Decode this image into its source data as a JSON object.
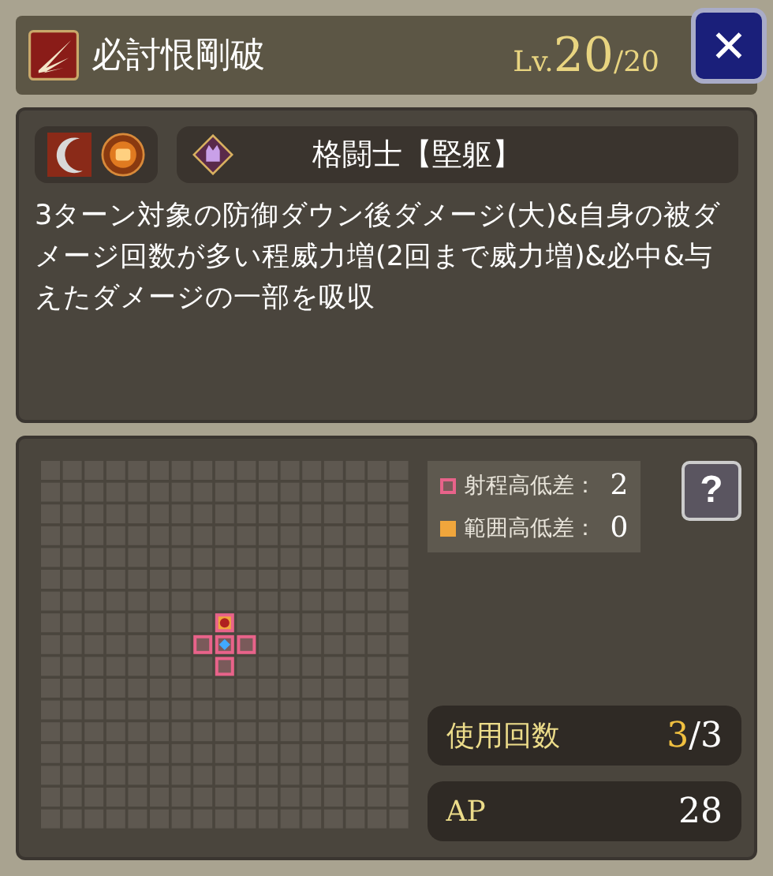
{
  "header": {
    "title": "必討恨剛破",
    "level_prefix": "Lv.",
    "level": "20",
    "level_max": "/20",
    "close": "✕"
  },
  "skill": {
    "job": "格闘士【堅躯】",
    "description": "3ターン対象の防御ダウン後ダメージ(大)&自身の被ダメージ回数が多い程威力増(2回まで威力増)&必中&与えたダメージの一部を吸収"
  },
  "range_grid": {
    "rows": [
      {
        "cells": [
          {
            "kind": "empty"
          },
          {
            "kind": "empty"
          },
          {
            "kind": "empty"
          },
          {
            "kind": "empty"
          },
          {
            "kind": "empty"
          },
          {
            "kind": "empty"
          },
          {
            "kind": "empty"
          },
          {
            "kind": "empty"
          },
          {
            "kind": "empty"
          },
          {
            "kind": "empty"
          },
          {
            "kind": "empty"
          },
          {
            "kind": "empty"
          },
          {
            "kind": "empty"
          },
          {
            "kind": "empty"
          },
          {
            "kind": "empty"
          },
          {
            "kind": "empty"
          },
          {
            "kind": "empty"
          }
        ]
      },
      {
        "cells": [
          {
            "kind": "empty"
          },
          {
            "kind": "empty"
          },
          {
            "kind": "empty"
          },
          {
            "kind": "empty"
          },
          {
            "kind": "empty"
          },
          {
            "kind": "empty"
          },
          {
            "kind": "empty"
          },
          {
            "kind": "empty"
          },
          {
            "kind": "empty"
          },
          {
            "kind": "empty"
          },
          {
            "kind": "empty"
          },
          {
            "kind": "empty"
          },
          {
            "kind": "empty"
          },
          {
            "kind": "empty"
          },
          {
            "kind": "empty"
          },
          {
            "kind": "empty"
          },
          {
            "kind": "empty"
          }
        ]
      },
      {
        "cells": [
          {
            "kind": "empty"
          },
          {
            "kind": "empty"
          },
          {
            "kind": "empty"
          },
          {
            "kind": "empty"
          },
          {
            "kind": "empty"
          },
          {
            "kind": "empty"
          },
          {
            "kind": "empty"
          },
          {
            "kind": "empty"
          },
          {
            "kind": "empty"
          },
          {
            "kind": "empty"
          },
          {
            "kind": "empty"
          },
          {
            "kind": "empty"
          },
          {
            "kind": "empty"
          },
          {
            "kind": "empty"
          },
          {
            "kind": "empty"
          },
          {
            "kind": "empty"
          },
          {
            "kind": "empty"
          }
        ]
      },
      {
        "cells": [
          {
            "kind": "empty"
          },
          {
            "kind": "empty"
          },
          {
            "kind": "empty"
          },
          {
            "kind": "empty"
          },
          {
            "kind": "empty"
          },
          {
            "kind": "empty"
          },
          {
            "kind": "empty"
          },
          {
            "kind": "empty"
          },
          {
            "kind": "empty"
          },
          {
            "kind": "empty"
          },
          {
            "kind": "empty"
          },
          {
            "kind": "empty"
          },
          {
            "kind": "empty"
          },
          {
            "kind": "empty"
          },
          {
            "kind": "empty"
          },
          {
            "kind": "empty"
          },
          {
            "kind": "empty"
          }
        ]
      },
      {
        "cells": [
          {
            "kind": "empty"
          },
          {
            "kind": "empty"
          },
          {
            "kind": "empty"
          },
          {
            "kind": "empty"
          },
          {
            "kind": "empty"
          },
          {
            "kind": "empty"
          },
          {
            "kind": "empty"
          },
          {
            "kind": "empty"
          },
          {
            "kind": "empty"
          },
          {
            "kind": "empty"
          },
          {
            "kind": "empty"
          },
          {
            "kind": "empty"
          },
          {
            "kind": "empty"
          },
          {
            "kind": "empty"
          },
          {
            "kind": "empty"
          },
          {
            "kind": "empty"
          },
          {
            "kind": "empty"
          }
        ]
      },
      {
        "cells": [
          {
            "kind": "empty"
          },
          {
            "kind": "empty"
          },
          {
            "kind": "empty"
          },
          {
            "kind": "empty"
          },
          {
            "kind": "empty"
          },
          {
            "kind": "empty"
          },
          {
            "kind": "empty"
          },
          {
            "kind": "empty"
          },
          {
            "kind": "empty"
          },
          {
            "kind": "empty"
          },
          {
            "kind": "empty"
          },
          {
            "kind": "empty"
          },
          {
            "kind": "empty"
          },
          {
            "kind": "empty"
          },
          {
            "kind": "empty"
          },
          {
            "kind": "empty"
          },
          {
            "kind": "empty"
          }
        ]
      },
      {
        "cells": [
          {
            "kind": "empty"
          },
          {
            "kind": "empty"
          },
          {
            "kind": "empty"
          },
          {
            "kind": "empty"
          },
          {
            "kind": "empty"
          },
          {
            "kind": "empty"
          },
          {
            "kind": "empty"
          },
          {
            "kind": "empty"
          },
          {
            "kind": "empty"
          },
          {
            "kind": "empty"
          },
          {
            "kind": "empty"
          },
          {
            "kind": "empty"
          },
          {
            "kind": "empty"
          },
          {
            "kind": "empty"
          },
          {
            "kind": "empty"
          },
          {
            "kind": "empty"
          },
          {
            "kind": "empty"
          }
        ]
      },
      {
        "cells": [
          {
            "kind": "empty"
          },
          {
            "kind": "empty"
          },
          {
            "kind": "empty"
          },
          {
            "kind": "empty"
          },
          {
            "kind": "empty"
          },
          {
            "kind": "empty"
          },
          {
            "kind": "empty"
          },
          {
            "kind": "empty"
          },
          {
            "kind": "target"
          },
          {
            "kind": "empty"
          },
          {
            "kind": "empty"
          },
          {
            "kind": "empty"
          },
          {
            "kind": "empty"
          },
          {
            "kind": "empty"
          },
          {
            "kind": "empty"
          },
          {
            "kind": "empty"
          },
          {
            "kind": "empty"
          }
        ]
      },
      {
        "cells": [
          {
            "kind": "empty"
          },
          {
            "kind": "empty"
          },
          {
            "kind": "empty"
          },
          {
            "kind": "empty"
          },
          {
            "kind": "empty"
          },
          {
            "kind": "empty"
          },
          {
            "kind": "empty"
          },
          {
            "kind": "range"
          },
          {
            "kind": "caster"
          },
          {
            "kind": "range"
          },
          {
            "kind": "empty"
          },
          {
            "kind": "empty"
          },
          {
            "kind": "empty"
          },
          {
            "kind": "empty"
          },
          {
            "kind": "empty"
          },
          {
            "kind": "empty"
          },
          {
            "kind": "empty"
          }
        ]
      },
      {
        "cells": [
          {
            "kind": "empty"
          },
          {
            "kind": "empty"
          },
          {
            "kind": "empty"
          },
          {
            "kind": "empty"
          },
          {
            "kind": "empty"
          },
          {
            "kind": "empty"
          },
          {
            "kind": "empty"
          },
          {
            "kind": "empty"
          },
          {
            "kind": "range"
          },
          {
            "kind": "empty"
          },
          {
            "kind": "empty"
          },
          {
            "kind": "empty"
          },
          {
            "kind": "empty"
          },
          {
            "kind": "empty"
          },
          {
            "kind": "empty"
          },
          {
            "kind": "empty"
          },
          {
            "kind": "empty"
          }
        ]
      },
      {
        "cells": [
          {
            "kind": "empty"
          },
          {
            "kind": "empty"
          },
          {
            "kind": "empty"
          },
          {
            "kind": "empty"
          },
          {
            "kind": "empty"
          },
          {
            "kind": "empty"
          },
          {
            "kind": "empty"
          },
          {
            "kind": "empty"
          },
          {
            "kind": "empty"
          },
          {
            "kind": "empty"
          },
          {
            "kind": "empty"
          },
          {
            "kind": "empty"
          },
          {
            "kind": "empty"
          },
          {
            "kind": "empty"
          },
          {
            "kind": "empty"
          },
          {
            "kind": "empty"
          },
          {
            "kind": "empty"
          }
        ]
      },
      {
        "cells": [
          {
            "kind": "empty"
          },
          {
            "kind": "empty"
          },
          {
            "kind": "empty"
          },
          {
            "kind": "empty"
          },
          {
            "kind": "empty"
          },
          {
            "kind": "empty"
          },
          {
            "kind": "empty"
          },
          {
            "kind": "empty"
          },
          {
            "kind": "empty"
          },
          {
            "kind": "empty"
          },
          {
            "kind": "empty"
          },
          {
            "kind": "empty"
          },
          {
            "kind": "empty"
          },
          {
            "kind": "empty"
          },
          {
            "kind": "empty"
          },
          {
            "kind": "empty"
          },
          {
            "kind": "empty"
          }
        ]
      },
      {
        "cells": [
          {
            "kind": "empty"
          },
          {
            "kind": "empty"
          },
          {
            "kind": "empty"
          },
          {
            "kind": "empty"
          },
          {
            "kind": "empty"
          },
          {
            "kind": "empty"
          },
          {
            "kind": "empty"
          },
          {
            "kind": "empty"
          },
          {
            "kind": "empty"
          },
          {
            "kind": "empty"
          },
          {
            "kind": "empty"
          },
          {
            "kind": "empty"
          },
          {
            "kind": "empty"
          },
          {
            "kind": "empty"
          },
          {
            "kind": "empty"
          },
          {
            "kind": "empty"
          },
          {
            "kind": "empty"
          }
        ]
      },
      {
        "cells": [
          {
            "kind": "empty"
          },
          {
            "kind": "empty"
          },
          {
            "kind": "empty"
          },
          {
            "kind": "empty"
          },
          {
            "kind": "empty"
          },
          {
            "kind": "empty"
          },
          {
            "kind": "empty"
          },
          {
            "kind": "empty"
          },
          {
            "kind": "empty"
          },
          {
            "kind": "empty"
          },
          {
            "kind": "empty"
          },
          {
            "kind": "empty"
          },
          {
            "kind": "empty"
          },
          {
            "kind": "empty"
          },
          {
            "kind": "empty"
          },
          {
            "kind": "empty"
          },
          {
            "kind": "empty"
          }
        ]
      },
      {
        "cells": [
          {
            "kind": "empty"
          },
          {
            "kind": "empty"
          },
          {
            "kind": "empty"
          },
          {
            "kind": "empty"
          },
          {
            "kind": "empty"
          },
          {
            "kind": "empty"
          },
          {
            "kind": "empty"
          },
          {
            "kind": "empty"
          },
          {
            "kind": "empty"
          },
          {
            "kind": "empty"
          },
          {
            "kind": "empty"
          },
          {
            "kind": "empty"
          },
          {
            "kind": "empty"
          },
          {
            "kind": "empty"
          },
          {
            "kind": "empty"
          },
          {
            "kind": "empty"
          },
          {
            "kind": "empty"
          }
        ]
      },
      {
        "cells": [
          {
            "kind": "empty"
          },
          {
            "kind": "empty"
          },
          {
            "kind": "empty"
          },
          {
            "kind": "empty"
          },
          {
            "kind": "empty"
          },
          {
            "kind": "empty"
          },
          {
            "kind": "empty"
          },
          {
            "kind": "empty"
          },
          {
            "kind": "empty"
          },
          {
            "kind": "empty"
          },
          {
            "kind": "empty"
          },
          {
            "kind": "empty"
          },
          {
            "kind": "empty"
          },
          {
            "kind": "empty"
          },
          {
            "kind": "empty"
          },
          {
            "kind": "empty"
          },
          {
            "kind": "empty"
          }
        ]
      },
      {
        "cells": [
          {
            "kind": "empty"
          },
          {
            "kind": "empty"
          },
          {
            "kind": "empty"
          },
          {
            "kind": "empty"
          },
          {
            "kind": "empty"
          },
          {
            "kind": "empty"
          },
          {
            "kind": "empty"
          },
          {
            "kind": "empty"
          },
          {
            "kind": "empty"
          },
          {
            "kind": "empty"
          },
          {
            "kind": "empty"
          },
          {
            "kind": "empty"
          },
          {
            "kind": "empty"
          },
          {
            "kind": "empty"
          },
          {
            "kind": "empty"
          },
          {
            "kind": "empty"
          },
          {
            "kind": "empty"
          }
        ]
      }
    ]
  },
  "legend": [
    {
      "label": "射程高低差：",
      "value": "2",
      "kind": "outline",
      "color": "#e8638a"
    },
    {
      "label": "範囲高低差：",
      "value": "0",
      "kind": "filled",
      "color": "#f0a63c"
    }
  ],
  "help": "?",
  "stats": [
    {
      "label": "使用回数",
      "current": "3",
      "total": "/3"
    },
    {
      "label": "AP",
      "current": "28"
    }
  ]
}
